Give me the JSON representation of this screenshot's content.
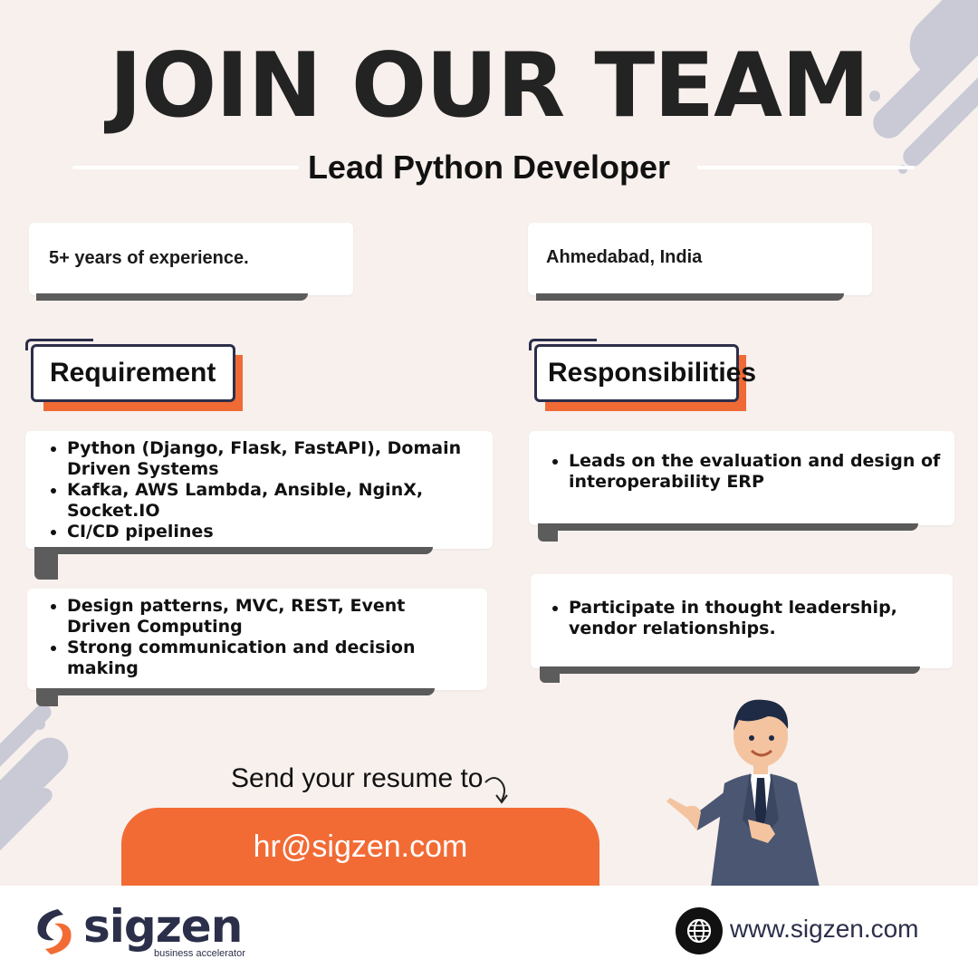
{
  "header": {
    "title": "JOIN OUR TEAM",
    "role": "Lead Python Developer"
  },
  "info": {
    "experience": "5+ years of experience.",
    "location": "Ahmedabad, India"
  },
  "sections": {
    "requirement_label": "Requirement",
    "responsibilities_label": "Responsibilities"
  },
  "requirements": {
    "box1": [
      "Python (Django, Flask, FastAPI), Domain Driven Systems",
      "Kafka, AWS Lambda, Ansible, NginX, Socket.IO",
      "CI/CD pipelines"
    ],
    "box2": [
      "Design patterns, MVC, REST, Event Driven Computing",
      "Strong communication and decision making"
    ]
  },
  "responsibilities": {
    "box1": [
      "Leads on the evaluation and design of interoperability ERP"
    ],
    "box2": [
      "Participate in thought leadership, vendor relationships."
    ]
  },
  "cta": {
    "prompt": "Send your resume to",
    "email": "hr@sigzen.com"
  },
  "footer": {
    "brand": "sigzen",
    "tagline": "business accelerator",
    "website": "www.sigzen.com"
  },
  "colors": {
    "background": "#f7f0ed",
    "accent": "#f26b35",
    "navy": "#2c2f4a",
    "stripe": "#c9cad6"
  },
  "icons": [
    "globe-icon",
    "sigzen-logo-icon",
    "curved-arrow-icon",
    "businessman-illustration"
  ]
}
